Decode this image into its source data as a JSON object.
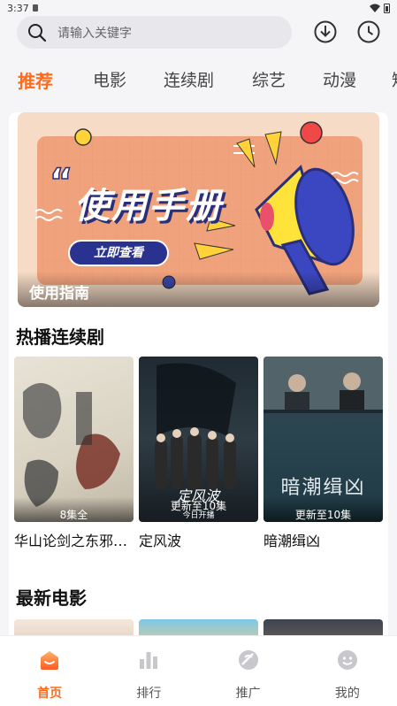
{
  "status_bar": {
    "time": "3:37"
  },
  "search": {
    "placeholder": "请输入关键字"
  },
  "tabs": [
    {
      "label": "推荐",
      "active": true
    },
    {
      "label": "电影"
    },
    {
      "label": "连续剧"
    },
    {
      "label": "综艺"
    },
    {
      "label": "动漫"
    },
    {
      "label": "短"
    }
  ],
  "banner": {
    "headline": "使用手册",
    "button_label": "立即查看",
    "caption": "使用指南"
  },
  "sections": {
    "hot_series": {
      "title": "热播连续剧",
      "items": [
        {
          "title": "华山论剑之东邪西毒",
          "badge": "8集全"
        },
        {
          "title": "定风波",
          "badge": "更新至10集",
          "poster_text": "今日开播"
        },
        {
          "title": "暗潮缉凶",
          "badge": "更新至10集",
          "poster_text": "暗潮缉凶"
        }
      ]
    },
    "new_movies": {
      "title": "最新电影"
    }
  },
  "bottom_nav": [
    {
      "label": "首页",
      "icon": "home-icon",
      "active": true
    },
    {
      "label": "排行",
      "icon": "ranking-icon"
    },
    {
      "label": "推广",
      "icon": "promote-icon"
    },
    {
      "label": "我的",
      "icon": "profile-icon"
    }
  ],
  "colors": {
    "accent": "#ff6b1a"
  }
}
